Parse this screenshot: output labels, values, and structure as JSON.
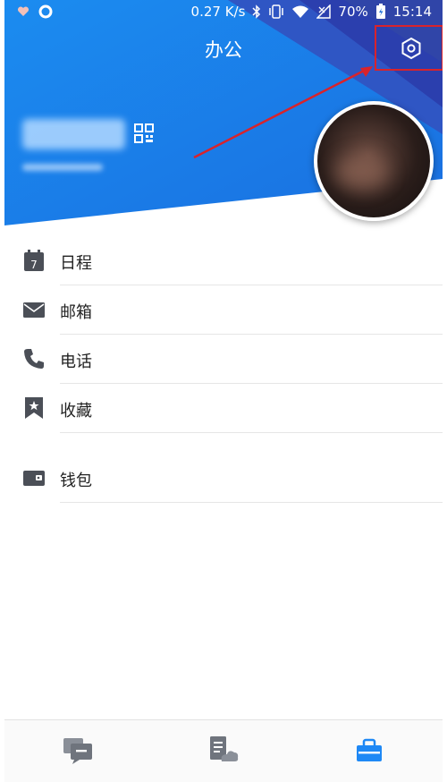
{
  "status_bar": {
    "speed": "0.27 K/s",
    "battery": "70%",
    "time": "15:14"
  },
  "header": {
    "title": "办公"
  },
  "menu": [
    {
      "label": "日程",
      "icon": "calendar-icon",
      "badge": "7"
    },
    {
      "label": "邮箱",
      "icon": "mail-icon"
    },
    {
      "label": "电话",
      "icon": "phone-icon"
    },
    {
      "label": "收藏",
      "icon": "bookmark-star-icon"
    },
    {
      "label": "钱包",
      "icon": "wallet-icon"
    }
  ],
  "tabbar": {
    "tabs": [
      {
        "icon": "chat-icon"
      },
      {
        "icon": "cloud-doc-icon"
      },
      {
        "icon": "work-icon",
        "active": true
      }
    ]
  },
  "colors": {
    "header_blue": "#1d86ea",
    "header_dark": "#2b3fae",
    "highlight_red": "#d9232b",
    "active_tab": "#1e88f5",
    "icon_gray": "#4b4f57"
  }
}
